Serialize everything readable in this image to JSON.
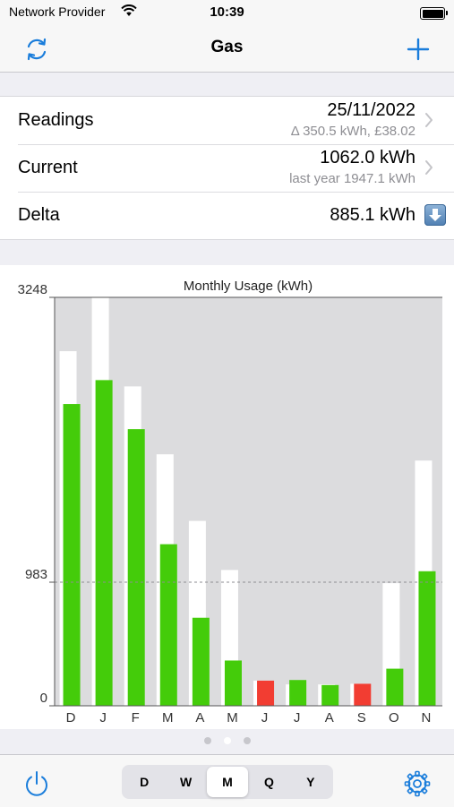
{
  "status_bar": {
    "carrier": "Network Provider",
    "time": "10:39"
  },
  "nav": {
    "title": "Gas",
    "refresh_icon": "refresh-icon",
    "add_icon": "plus-icon",
    "accent": "#1a7ddb"
  },
  "rows": {
    "readings": {
      "label": "Readings",
      "value": "25/11/2022",
      "detail": "Δ 350.5 kWh, £38.02"
    },
    "current": {
      "label": "Current",
      "value": "1062.0 kWh",
      "detail": "last year 1947.1 kWh"
    },
    "delta": {
      "label": "Delta",
      "value": "885.1 kWh",
      "icon": "down-arrow-icon"
    }
  },
  "chart_data": {
    "type": "bar",
    "title": "Monthly Usage (kWh)",
    "categories": [
      "D",
      "J",
      "F",
      "M",
      "A",
      "M",
      "J",
      "J",
      "A",
      "S",
      "O",
      "N"
    ],
    "series": [
      {
        "values": [
          2820,
          3248,
          2540,
          2000,
          1470,
          1080,
          200,
          170,
          170,
          175,
          975,
          1950
        ]
      },
      {
        "values": [
          2400,
          2590,
          2200,
          1285,
          700,
          360,
          200,
          205,
          165,
          175,
          295,
          1070
        ]
      }
    ],
    "bar_colors": [
      "#ffffff",
      "#44cc0a",
      "#44cc0a",
      "#44cc0a",
      "#44cc0a",
      "#44cc0a",
      "#44cc0a",
      "#f23d32",
      "#44cc0a",
      "#44cc0a",
      "#f23d32",
      "#44cc0a",
      "#44cc0a"
    ],
    "colors": {
      "previous": "#ffffff",
      "above": "#44cc0a",
      "below": "#f23d32",
      "plot_bg": "#dcdcde"
    },
    "ytick_labels": [
      "3248",
      "983",
      "0"
    ],
    "yticks": [
      3248,
      983,
      0
    ],
    "reference_line": 983,
    "ylim": [
      0,
      3248
    ],
    "grid": false
  },
  "pager": {
    "pages": 3,
    "active": 1
  },
  "toolbar": {
    "power_icon": "power-icon",
    "settings_icon": "gear-icon",
    "segments": [
      "D",
      "W",
      "M",
      "Q",
      "Y"
    ],
    "selected": "M"
  }
}
